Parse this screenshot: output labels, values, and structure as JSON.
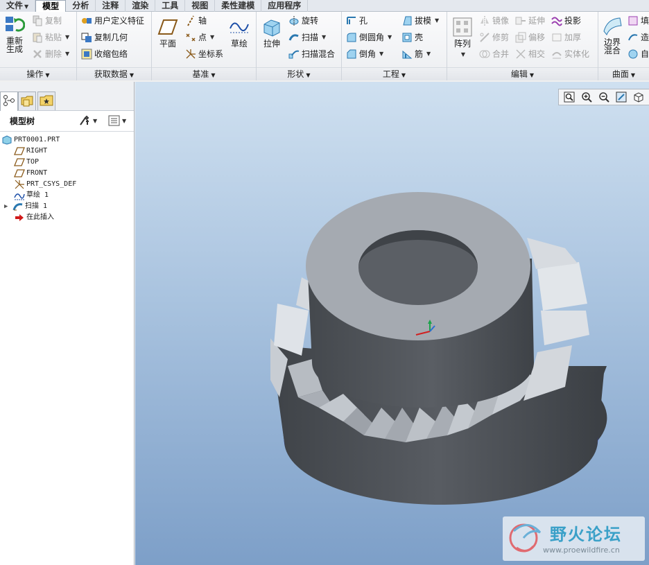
{
  "menu": {
    "tabs": [
      "文件",
      "模型",
      "分析",
      "注释",
      "渲染",
      "工具",
      "视图",
      "柔性建模",
      "应用程序"
    ],
    "active_tab": "模型"
  },
  "ribbon": {
    "operations": {
      "label": "操作",
      "regenerate": "重新生成",
      "copy": "复制",
      "paste": "粘贴",
      "delete": "删除"
    },
    "get_data": {
      "label": "获取数据",
      "user_defined_feature": "用户定义特征",
      "copy_geometry": "复制几何",
      "shrinkwrap": "收缩包络"
    },
    "datum": {
      "label": "基准",
      "plane": "平面",
      "axis": "轴",
      "point": "点",
      "csys": "坐标系",
      "sketch": "草绘"
    },
    "shapes": {
      "label": "形状",
      "extrude": "拉伸",
      "revolve": "旋转",
      "sweep": "扫描",
      "swept_blend": "扫描混合"
    },
    "engineering": {
      "label": "工程",
      "hole": "孔",
      "round": "倒圆角",
      "chamfer": "倒角",
      "draft": "拔模",
      "shell": "壳",
      "rib": "筋"
    },
    "editing": {
      "label": "编辑",
      "pattern": "阵列",
      "mirror": "镜像",
      "trim": "修剪",
      "merge": "合并",
      "extend": "延伸",
      "offset": "偏移",
      "intersect": "相交",
      "project": "投影",
      "thicken": "加厚",
      "solidify": "实体化"
    },
    "surfaces": {
      "label": "曲面",
      "boundary_blend": "边界混合",
      "fill_partial": "填",
      "style_partial": "造",
      "freestyle_partial": "自"
    }
  },
  "model_tree": {
    "header": "模型树",
    "nodes": [
      {
        "label": "PRT0001.PRT",
        "icon": "part-icon"
      },
      {
        "label": "RIGHT",
        "icon": "datum-plane-icon"
      },
      {
        "label": "TOP",
        "icon": "datum-plane-icon"
      },
      {
        "label": "FRONT",
        "icon": "datum-plane-icon"
      },
      {
        "label": "PRT_CSYS_DEF",
        "icon": "csys-icon"
      },
      {
        "label": "草绘 1",
        "icon": "sketch-icon"
      },
      {
        "label": "扫描 1",
        "icon": "sweep-icon"
      },
      {
        "label": "在此插入",
        "icon": "insert-here-icon"
      }
    ]
  },
  "watermark": {
    "title": "野火论坛",
    "url": "www.proewildfire.cn"
  },
  "colors": {
    "accent_tab": "#ffffff",
    "viewport_top": "#cfe0f0",
    "viewport_bottom": "#7d9fc8",
    "model_top_face": "#a5aab1",
    "model_side": "#4b4f55",
    "watermark_text": "#3aa0c8"
  }
}
